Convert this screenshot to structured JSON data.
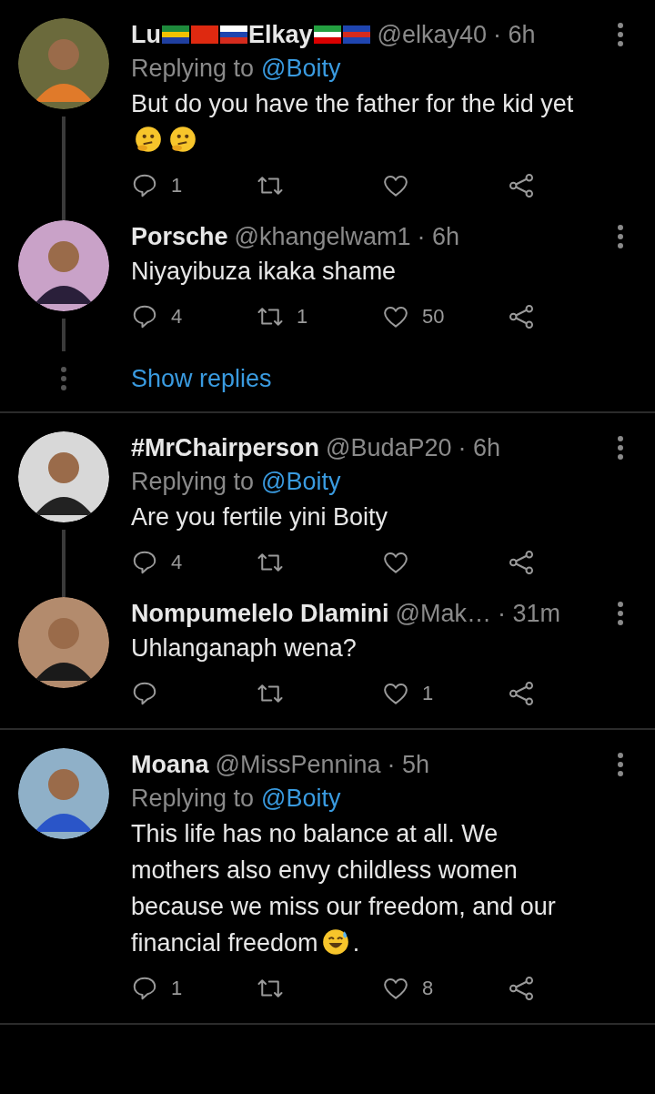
{
  "threads": [
    {
      "tweets": [
        {
          "name_parts": [
            {
              "kind": "text",
              "text": "Lu"
            },
            {
              "kind": "flag"
            },
            {
              "kind": "flag"
            },
            {
              "kind": "flag"
            },
            {
              "kind": "text",
              "text": "Elkay"
            },
            {
              "kind": "flag"
            },
            {
              "kind": "flag"
            }
          ],
          "handle": "@elkay40",
          "time": "· 6h",
          "replying_label": "Replying to",
          "replying_to": "@Boity",
          "body": [
            {
              "kind": "line",
              "text": "But do you have the father for the kid yet"
            },
            {
              "kind": "thinking-emoji"
            },
            {
              "kind": "thinking-emoji"
            }
          ],
          "reply_count": "1"
        },
        {
          "name_parts": [
            {
              "kind": "text",
              "text": "Porsche"
            }
          ],
          "handle": "@khangelwam1",
          "time": "· 6h",
          "body": [
            {
              "kind": "text",
              "text": "Niyayibuza ikaka shame"
            }
          ],
          "reply_count": "4",
          "retweet_count": "1",
          "like_count": "50"
        }
      ],
      "show_replies": "Show replies"
    },
    {
      "tweets": [
        {
          "name_parts": [
            {
              "kind": "text",
              "text": "#MrChairperson"
            }
          ],
          "handle": "@BudaP20",
          "time": "· 6h",
          "replying_label": "Replying to",
          "replying_to": "@Boity",
          "body": [
            {
              "kind": "text",
              "text": "Are you fertile yini Boity"
            }
          ],
          "reply_count": "4"
        },
        {
          "name_parts": [
            {
              "kind": "text",
              "text": "Nompumelelo Dlamini"
            }
          ],
          "handle": "@Mak…",
          "time": "· 31m",
          "body": [
            {
              "kind": "text",
              "text": "Uhlanganaph wena?"
            }
          ],
          "like_count": "1"
        }
      ]
    },
    {
      "tweets": [
        {
          "name_parts": [
            {
              "kind": "text",
              "text": "Moana"
            }
          ],
          "handle": "@MissPennina",
          "time": "· 5h",
          "replying_label": "Replying to",
          "replying_to": "@Boity",
          "body": [
            {
              "kind": "line",
              "text": "This life has no balance at all. We"
            },
            {
              "kind": "line",
              "text": "mothers also envy childless women"
            },
            {
              "kind": "line",
              "text": "because we miss our freedom, and our"
            },
            {
              "kind": "text",
              "text": "financial freedom"
            },
            {
              "kind": "sweat-emoji"
            },
            {
              "kind": "text",
              "text": "."
            }
          ],
          "reply_count": "1",
          "like_count": "8"
        }
      ]
    }
  ]
}
